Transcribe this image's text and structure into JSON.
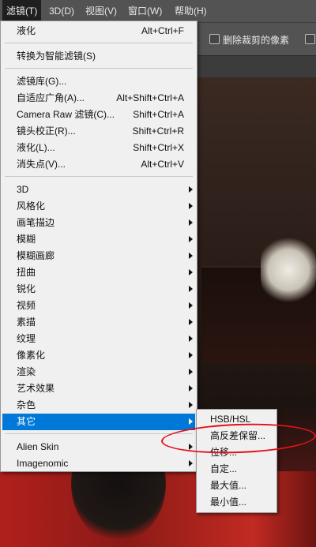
{
  "menubar": {
    "filter": "滤镜(T)",
    "threed": "3D(D)",
    "view": "视图(V)",
    "window": "窗口(W)",
    "help": "帮助(H)"
  },
  "options_bar": {
    "delete_cropped": "删除裁剪的像素"
  },
  "filter_menu": {
    "liquify_last": {
      "label": "液化",
      "shortcut": "Alt+Ctrl+F"
    },
    "convert_smart": {
      "label": "转换为智能滤镜(S)"
    },
    "gallery": {
      "label": "滤镜库(G)..."
    },
    "adaptive_wide": {
      "label": "自适应广角(A)...",
      "shortcut": "Alt+Shift+Ctrl+A"
    },
    "camera_raw": {
      "label": "Camera Raw 滤镜(C)...",
      "shortcut": "Shift+Ctrl+A"
    },
    "lens_correction": {
      "label": "镜头校正(R)...",
      "shortcut": "Shift+Ctrl+R"
    },
    "liquify": {
      "label": "液化(L)...",
      "shortcut": "Shift+Ctrl+X"
    },
    "vanishing_point": {
      "label": "消失点(V)...",
      "shortcut": "Alt+Ctrl+V"
    },
    "categories": [
      "3D",
      "风格化",
      "画笔描边",
      "模糊",
      "模糊画廊",
      "扭曲",
      "锐化",
      "视频",
      "素描",
      "纹理",
      "像素化",
      "渲染",
      "艺术效果",
      "杂色",
      "其它"
    ],
    "plugins": [
      "Alien Skin",
      "Imagenomic"
    ]
  },
  "other_submenu": {
    "items": [
      "HSB/HSL",
      "高反差保留...",
      "位移...",
      "自定...",
      "最大值...",
      "最小值..."
    ]
  }
}
